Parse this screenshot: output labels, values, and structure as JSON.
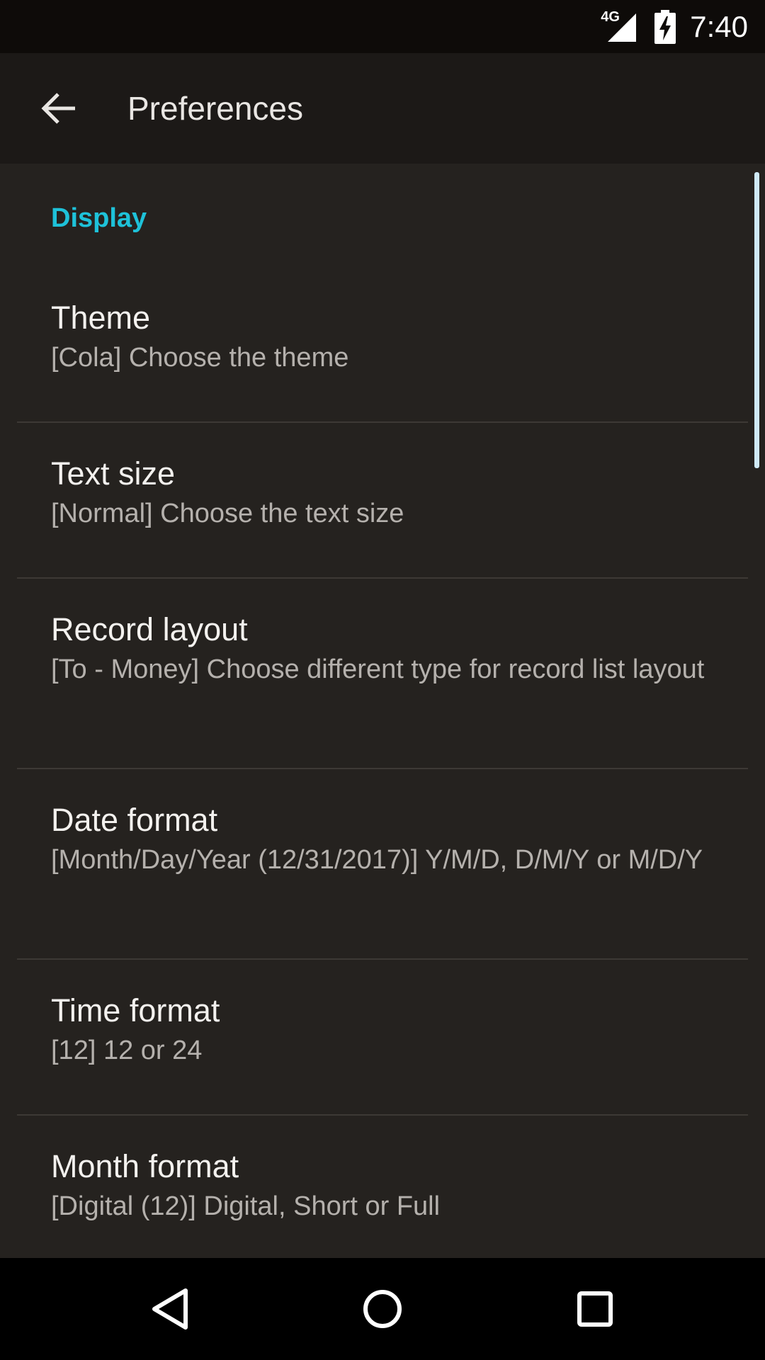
{
  "status_bar": {
    "network_label": "4G",
    "time": "7:40",
    "icons": [
      "signal-icon",
      "battery-charging-icon"
    ]
  },
  "app_bar": {
    "back_icon": "arrow-back-icon",
    "title": "Preferences"
  },
  "section": {
    "header": "Display",
    "accent_color": "#1ec2d9"
  },
  "preferences": [
    {
      "title": "Theme",
      "summary": "[Cola] Choose the theme"
    },
    {
      "title": "Text size",
      "summary": "[Normal] Choose the text size"
    },
    {
      "title": "Record layout",
      "summary": "[To - Money] Choose different type for record list layout"
    },
    {
      "title": "Date format",
      "summary": "[Month/Day/Year (12/31/2017)] Y/M/D, D/M/Y or M/D/Y"
    },
    {
      "title": "Time format",
      "summary": "[12] 12 or 24"
    },
    {
      "title": "Month format",
      "summary": "[Digital (12)] Digital, Short or Full"
    }
  ],
  "nav_bar": {
    "icons": [
      "back-triangle-icon",
      "home-circle-icon",
      "recents-square-icon"
    ]
  }
}
